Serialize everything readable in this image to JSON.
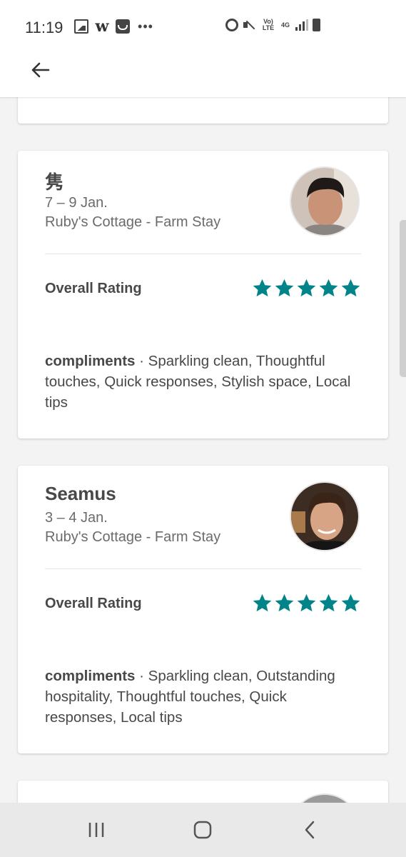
{
  "status_bar": {
    "time": "11:19",
    "left_icons": [
      "gallery-icon",
      "w-app-icon",
      "shopping-bag-icon",
      "more-dots-icon"
    ],
    "right_icons": [
      "alarm-icon",
      "mute-icon",
      "volte-icon",
      "4g-icon",
      "signal-icon",
      "battery-icon"
    ],
    "volte_text": "Vo) LTE",
    "network_text": "4G"
  },
  "header": {
    "back_icon": "arrow-left-icon"
  },
  "reviews": [
    {
      "name": "隽",
      "dates": "7 – 9 Jan.",
      "listing": "Ruby's Cottage - Farm Stay",
      "rating_label": "Overall Rating",
      "stars": 5,
      "compliments_label": "compliments",
      "compliments_separator": " · ",
      "compliments_text": "Sparkling clean, Thoughtful touches, Quick responses, Stylish space, Local tips"
    },
    {
      "name": "Seamus",
      "dates": "3 – 4 Jan.",
      "listing": "Ruby's Cottage - Farm Stay",
      "rating_label": "Overall Rating",
      "stars": 5,
      "compliments_label": "compliments",
      "compliments_separator": " · ",
      "compliments_text": "Sparkling clean, Outstanding hospitality, Thoughtful touches, Quick responses, Local tips"
    }
  ],
  "colors": {
    "star": "#008489",
    "text": "#484848",
    "secondary_text": "#6b6b6b"
  },
  "nav_bar": {
    "icons": [
      "recent-apps-icon",
      "home-icon",
      "back-icon"
    ]
  }
}
